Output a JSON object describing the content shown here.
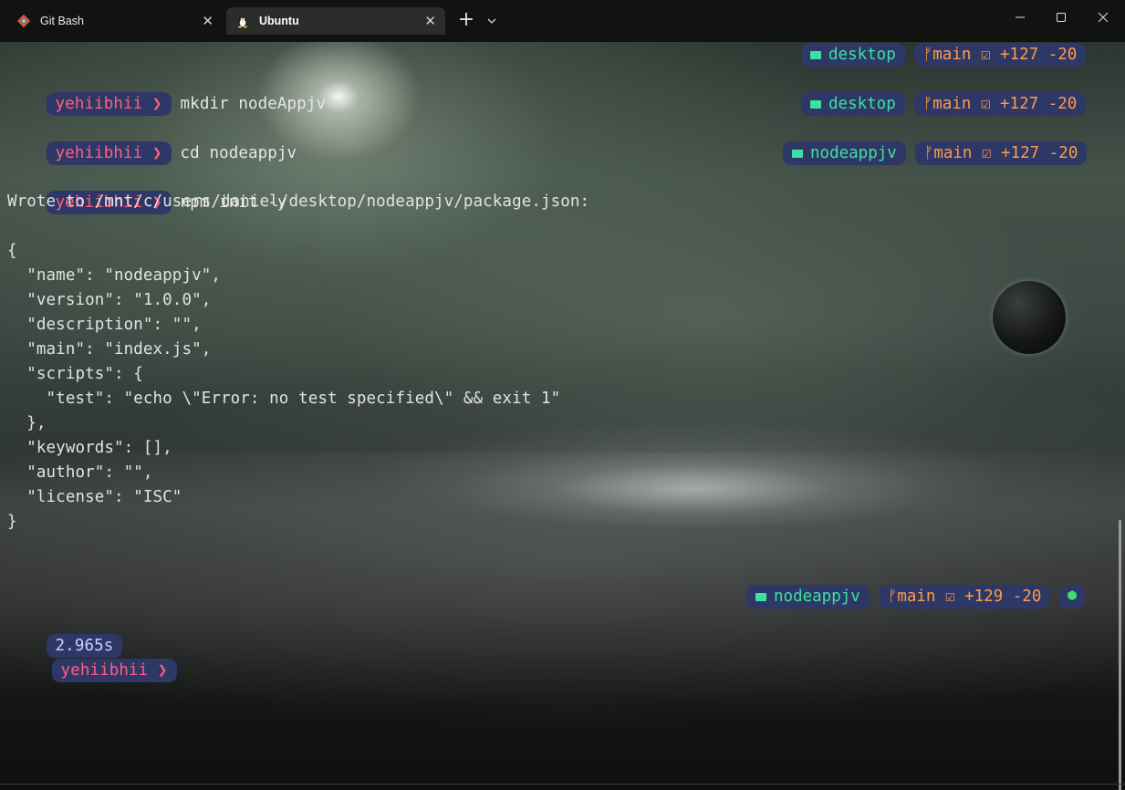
{
  "tabs": [
    {
      "label": "Git Bash",
      "icon": "git-bash-icon",
      "active": false
    },
    {
      "label": "Ubuntu",
      "icon": "linux-penguin-icon",
      "active": true
    }
  ],
  "tab_bar": {
    "new_tab": "+",
    "dropdown": "chevron-down-icon"
  },
  "window_controls": [
    "minimize-icon",
    "maximize-icon",
    "close-icon"
  ],
  "prompt": {
    "user": "yehiibhii",
    "arrow": "❯"
  },
  "commands": [
    {
      "user": "yehiibhii ❯",
      "command": "mkdir nodeAppjv"
    },
    {
      "user": "yehiibhii ❯",
      "command": "cd nodeappjv"
    },
    {
      "user": "yehiibhii ❯",
      "command": "npm init -y"
    }
  ],
  "output": [
    "Wrote to /mnt/c/users/daniel/desktop/nodeappjv/package.json:",
    "",
    "{",
    "  \"name\": \"nodeappjv\",",
    "  \"version\": \"1.0.0\",",
    "  \"description\": \"\",",
    "  \"main\": \"index.js\",",
    "  \"scripts\": {",
    "    \"test\": \"echo \\\"Error: no test specified\\\" && exit 1\"",
    "  },",
    "  \"keywords\": [],",
    "  \"author\": \"\",",
    "  \"license\": \"ISC\"",
    "}"
  ],
  "right_prompts": [
    {
      "dir": "desktop",
      "git": "ᚠmain ☑ +127 -20"
    },
    {
      "dir": "desktop",
      "git": "ᚠmain ☑ +127 -20"
    },
    {
      "dir": "nodeappjv",
      "git": "ᚠmain ☑ +127 -20"
    },
    {
      "dir": "nodeappjv",
      "git": "ᚠmain ☑ +129 -20",
      "node": "⬢"
    }
  ],
  "last_prompt": {
    "duration": "2.965s",
    "user": "yehiibhii ❯"
  },
  "colors": {
    "pill_bg": "#2e3866",
    "user": "#ff5f7e",
    "dir": "#3ee0a0",
    "git": "#ff9a4a"
  }
}
